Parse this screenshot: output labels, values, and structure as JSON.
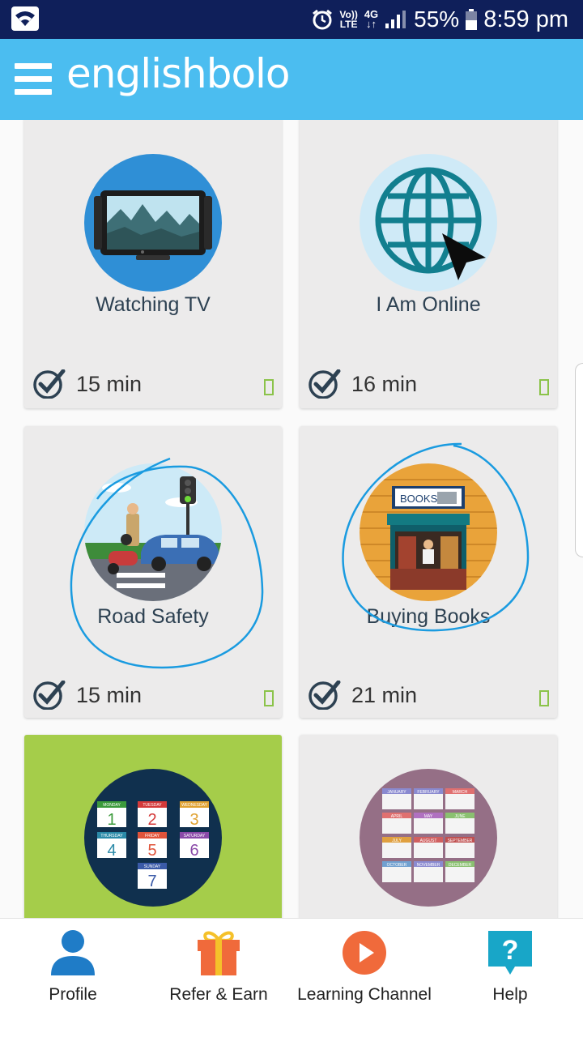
{
  "status_bar": {
    "network_line1": "Vo))",
    "network_line2": "LTE",
    "network_type_1": "4G",
    "network_type_2": "↓↑",
    "battery_percent": "55%",
    "time": "8:59 pm"
  },
  "app_bar": {
    "logo_text": "englishbolo",
    "menu_icon": "hamburger-menu-icon",
    "color": "#4bbdf0"
  },
  "lessons": [
    {
      "title": "Watching TV",
      "duration": "15 min",
      "icon": "tv-icon"
    },
    {
      "title": "I Am Online",
      "duration": "16 min",
      "icon": "globe-cursor-icon"
    },
    {
      "title": "Road Safety",
      "duration": "15 min",
      "icon": "traffic-scene-icon"
    },
    {
      "title": "Buying Books",
      "duration": "21 min",
      "icon": "bookshop-icon"
    },
    {
      "title": "",
      "duration": "",
      "icon": "days-of-week-icon"
    },
    {
      "title": "",
      "duration": "",
      "icon": "months-calendar-icon"
    }
  ],
  "weekdays": {
    "mon": "MONDAY",
    "tue": "TUESDAY",
    "wed": "WEDNESDAY",
    "thu": "THURSDAY",
    "fri": "FRIDAY",
    "sat": "SATURDAY",
    "sun": "SUNDAY",
    "n1": "1",
    "n2": "2",
    "n3": "3",
    "n4": "4",
    "n5": "5",
    "n6": "6",
    "n7": "7"
  },
  "months": {
    "jan": "JANUARY",
    "feb": "FEBRUARY",
    "mar": "MARCH",
    "apr": "APRIL",
    "may": "MAY",
    "jun": "JUNE",
    "jul": "JULY",
    "aug": "AUGUST",
    "sep": "SEPTEMBER",
    "oct": "OCTOBER",
    "nov": "NOVEMBER",
    "dec": "DECEMBER"
  },
  "bookshop_sign": "BOOKS",
  "bottom_nav": [
    {
      "label": "Profile",
      "icon": "profile-icon"
    },
    {
      "label": "Refer & Earn",
      "icon": "gift-icon"
    },
    {
      "label": "Learning Channel",
      "icon": "play-icon"
    },
    {
      "label": "Help",
      "icon": "help-icon"
    }
  ],
  "colors": {
    "status_bar": "#0f1f5a",
    "accent": "#4bbdf0",
    "card_background": "#ecebeb",
    "highlight_card": "#a5cd4a",
    "annotation_stroke": "#1a9be0"
  }
}
